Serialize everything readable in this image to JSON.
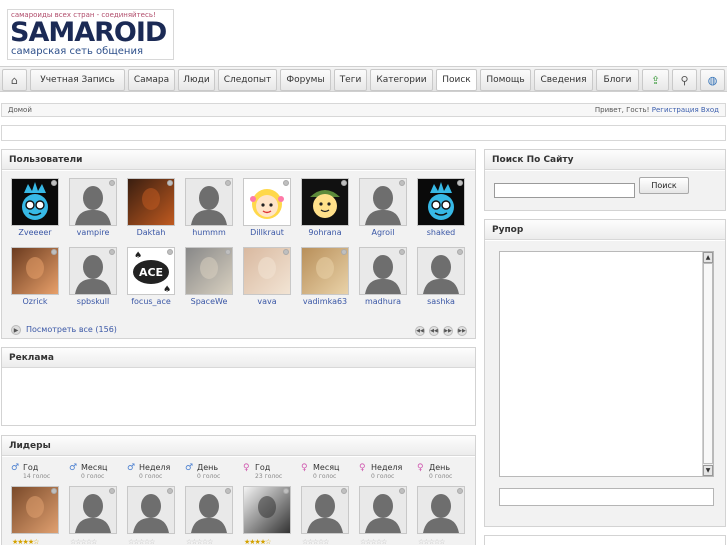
{
  "header": {
    "logo_slogan": "самароиды всех стран - соединяйтесь!",
    "logo_word": "SAMAROID",
    "logo_sub": "самарская сеть общения"
  },
  "nav": {
    "items": [
      "Учетная Запись",
      "Самара",
      "Люди",
      "Следопыт",
      "Форумы",
      "Теги",
      "Категории",
      "Поиск",
      "Помощь",
      "Сведения",
      "Блоги"
    ]
  },
  "breadcrumb": {
    "home": "Домой",
    "greeting": "Привет, Гость!",
    "register": "Регистрация",
    "login": "Вход"
  },
  "users": {
    "title": "Пользователи",
    "members": [
      "Zveeeer",
      "vampire",
      "Daktah",
      "hummm",
      "Dillkraut",
      "9ohrana",
      "Agroil",
      "shaked",
      "Ozrick",
      "spbskull",
      "focus_ace",
      "SpaceWe",
      "vava",
      "vadimka63",
      "madhura",
      "sashka"
    ],
    "see_all": "Посмотреть все (156)"
  },
  "ads": {
    "title": "Реклама"
  },
  "leaders": {
    "title": "Лидеры",
    "categories": [
      {
        "label": "Год",
        "votes": "14 голос",
        "gender": "male"
      },
      {
        "label": "Месяц",
        "votes": "0 голос",
        "gender": "male"
      },
      {
        "label": "Неделя",
        "votes": "0 голос",
        "gender": "male"
      },
      {
        "label": "День",
        "votes": "0 голос",
        "gender": "male"
      },
      {
        "label": "Год",
        "votes": "23 голос",
        "gender": "female"
      },
      {
        "label": "Месяц",
        "votes": "0 голос",
        "gender": "female"
      },
      {
        "label": "Неделя",
        "votes": "0 голос",
        "gender": "female"
      },
      {
        "label": "День",
        "votes": "0 голос",
        "gender": "female"
      }
    ]
  },
  "site_search": {
    "title": "Поиск По Сайту",
    "button": "Поиск",
    "value": ""
  },
  "shoutbox": {
    "title": "Рупор"
  },
  "colors": {
    "link": "#3a57a6",
    "accent_gold": "#d4a200"
  }
}
